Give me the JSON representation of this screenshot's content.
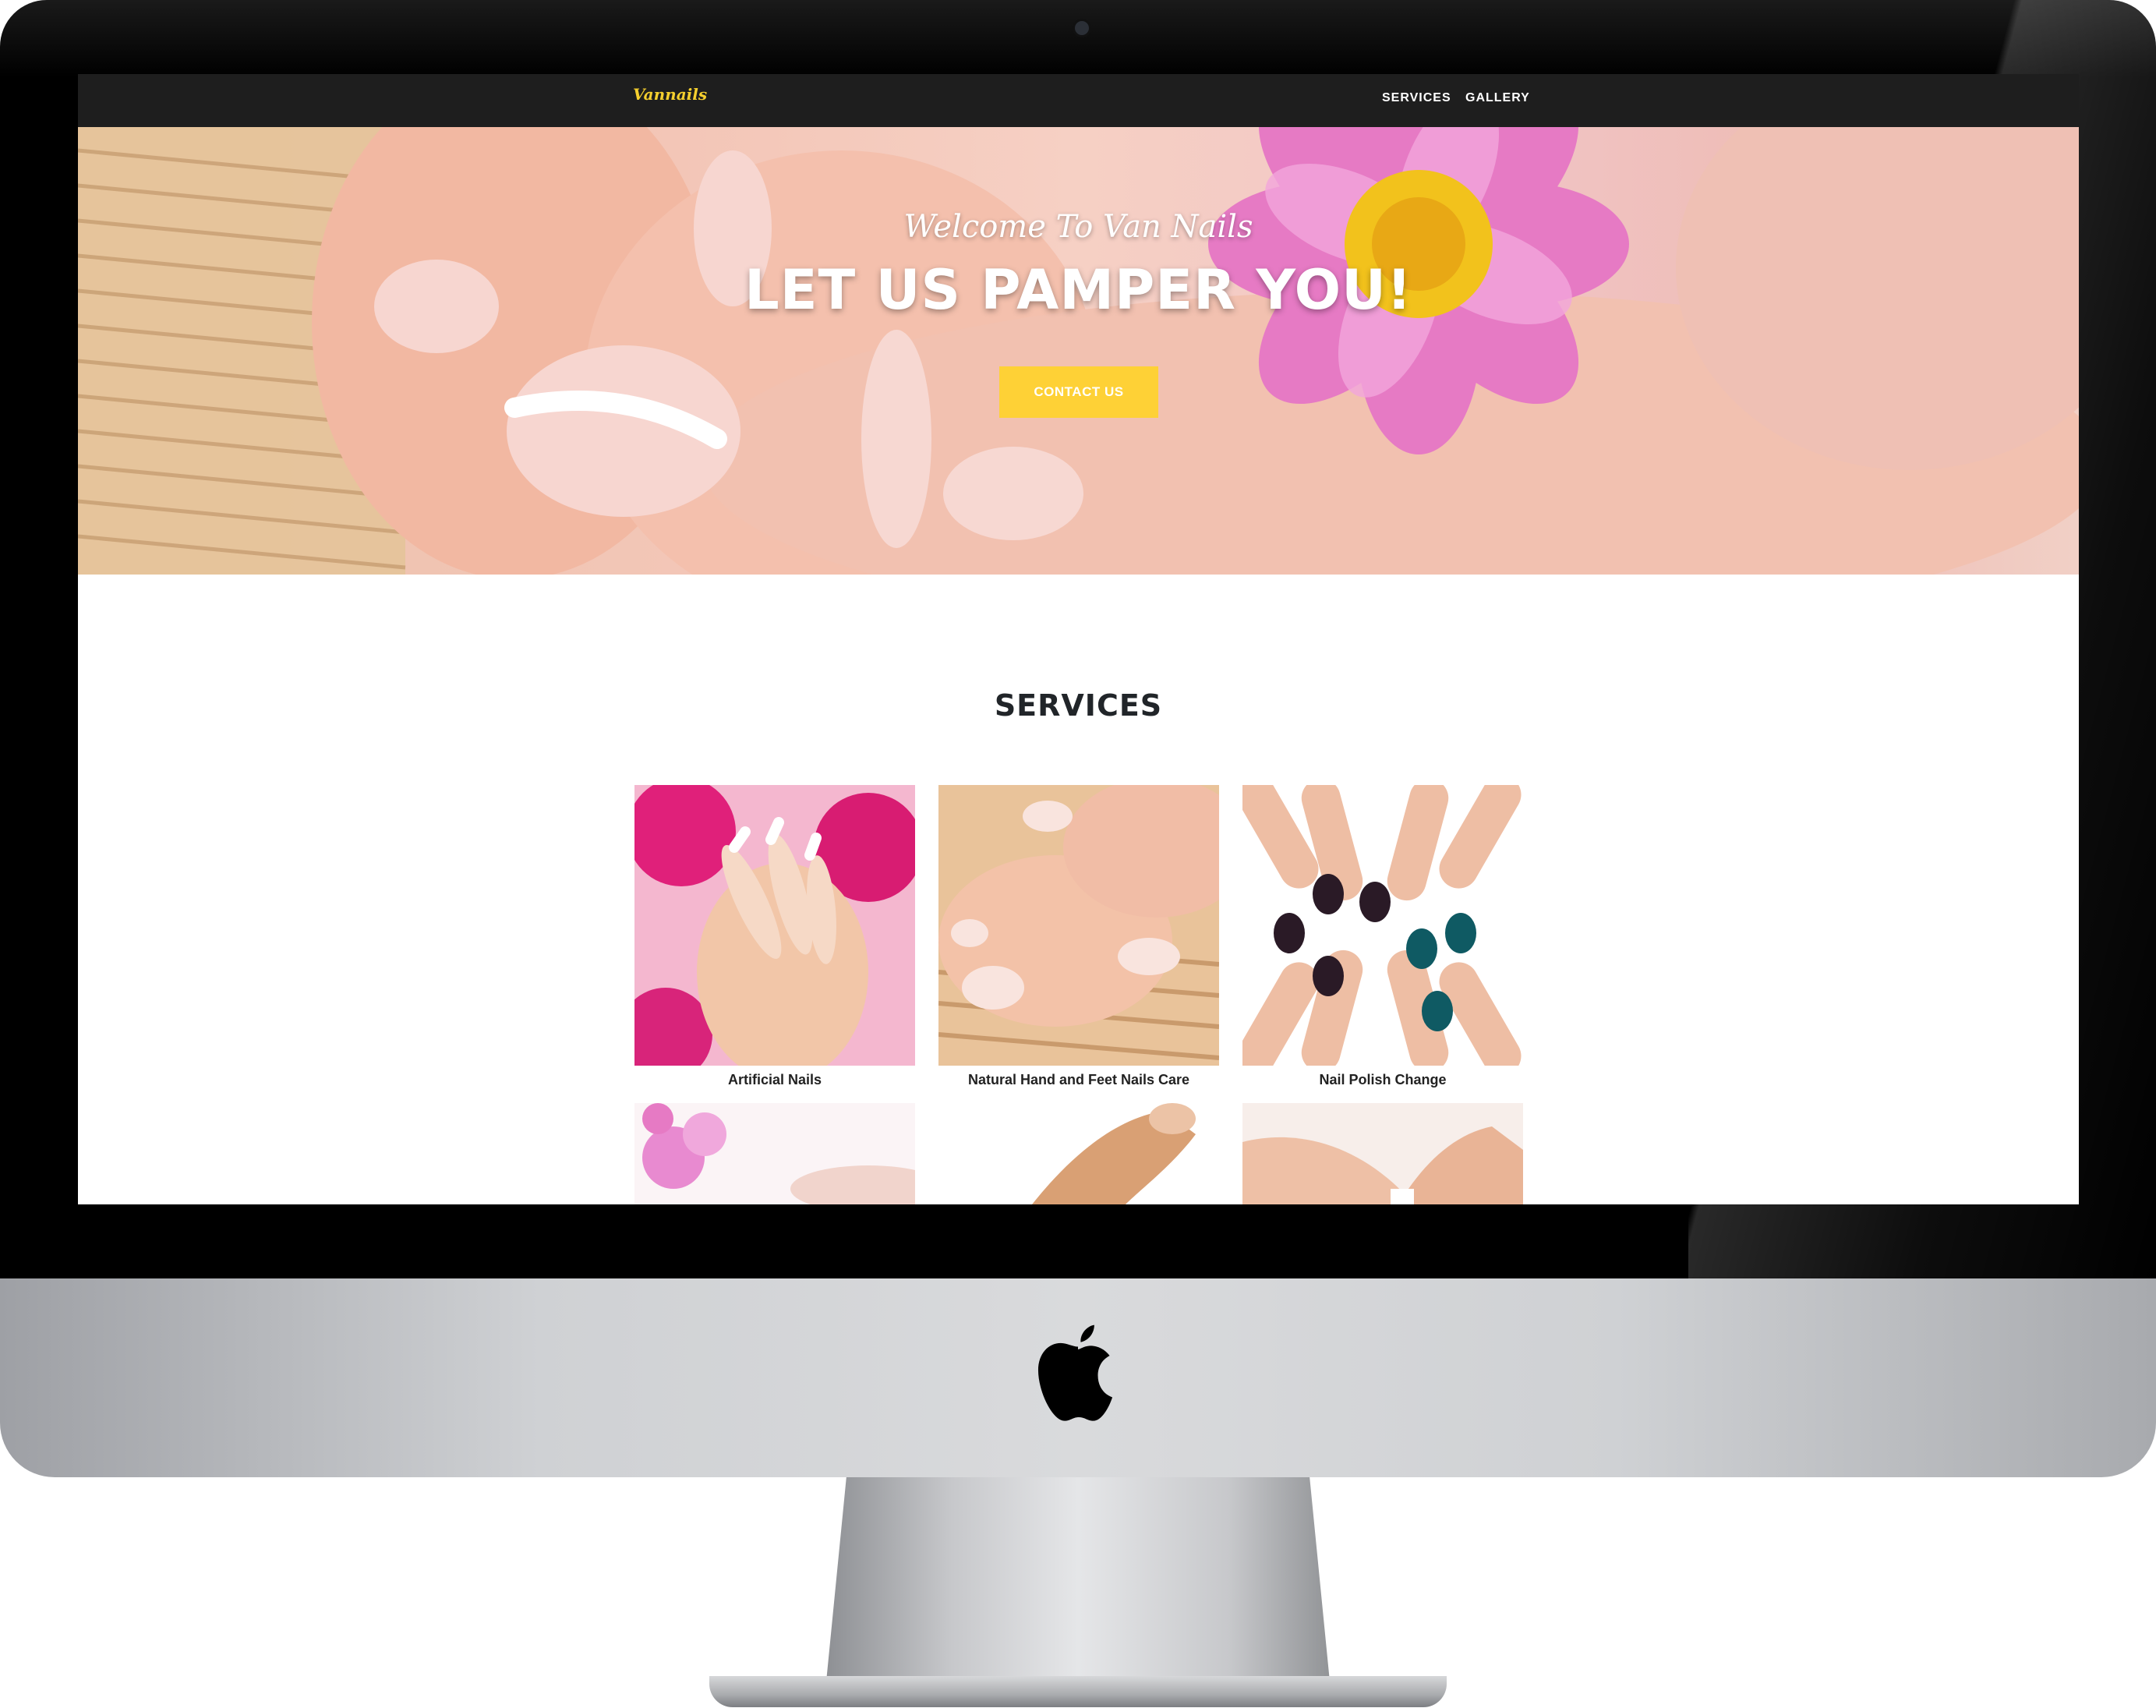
{
  "site": {
    "brand": "Vannails",
    "nav": [
      "SERVICES",
      "GALLERY"
    ]
  },
  "hero": {
    "subtitle": "Welcome To Van Nails",
    "title": "LET US PAMPER YOU!",
    "cta": "CONTACT US"
  },
  "services": {
    "heading": "SERVICES",
    "items": [
      {
        "caption": "Artificial Nails"
      },
      {
        "caption": "Natural Hand and Feet Nails Care"
      },
      {
        "caption": "Nail Polish Change"
      }
    ]
  },
  "colors": {
    "accent": "#fed136",
    "navbar": "#1e1e1e",
    "brand": "#f5cf2e"
  },
  "icons": [
    "apple-logo-icon",
    "camera-icon"
  ]
}
